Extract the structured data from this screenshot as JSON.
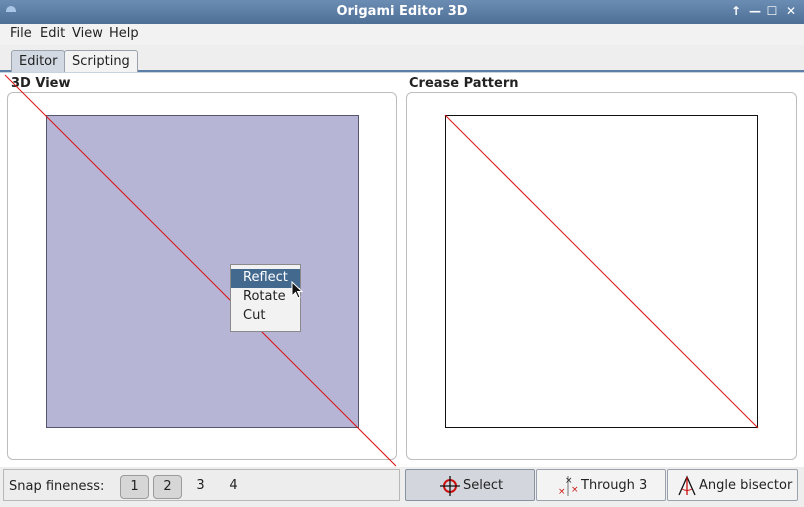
{
  "window": {
    "title": "Origami Editor 3D"
  },
  "menubar": {
    "items": [
      "File",
      "Edit",
      "View",
      "Help"
    ]
  },
  "tabs": {
    "editor": "Editor",
    "scripting": "Scripting"
  },
  "panels": {
    "view3d_title": "3D View",
    "crease_title": "Crease Pattern"
  },
  "context_menu": {
    "items": [
      "Reflect",
      "Rotate",
      "Cut"
    ],
    "selected": "Reflect"
  },
  "statusbar": {
    "snap_label": "Snap fineness:",
    "snap_options": [
      "1",
      "2",
      "3",
      "4"
    ],
    "tools": {
      "select": "Select",
      "through3": "Through 3",
      "angle_bisector": "Angle bisector"
    },
    "active_tool": "Select"
  },
  "colors": {
    "paper": "#b6b5d5",
    "crease": "#dd1111",
    "menu_highlight": "#44698f",
    "titlebar": "#5a7ca4"
  }
}
